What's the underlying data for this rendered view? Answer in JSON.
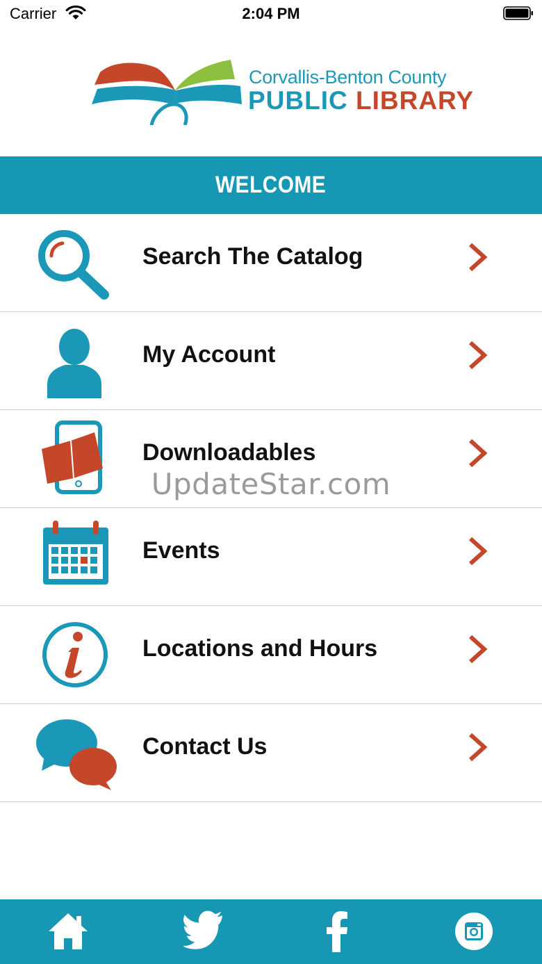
{
  "status_bar": {
    "carrier": "Carrier",
    "time": "2:04 PM"
  },
  "logo": {
    "line1": "Corvallis-Benton County",
    "line2_part1": "PUBLIC",
    "line2_part2": "LIBRARY"
  },
  "welcome": {
    "title": "WELCOME"
  },
  "menu": {
    "items": [
      {
        "label": "Search The Catalog",
        "icon": "magnifier-icon"
      },
      {
        "label": "My Account",
        "icon": "person-icon"
      },
      {
        "label": "Downloadables",
        "icon": "tablet-book-icon"
      },
      {
        "label": "Events",
        "icon": "calendar-icon"
      },
      {
        "label": "Locations and Hours",
        "icon": "info-icon"
      },
      {
        "label": "Contact Us",
        "icon": "chat-bubbles-icon"
      }
    ]
  },
  "watermark": "UpdateStar.com",
  "tab_bar": {
    "items": [
      "home-icon",
      "twitter-icon",
      "facebook-icon",
      "instagram-icon"
    ]
  },
  "colors": {
    "teal": "#1697b3",
    "orange": "#c4472a",
    "green": "#8cbf3f"
  }
}
